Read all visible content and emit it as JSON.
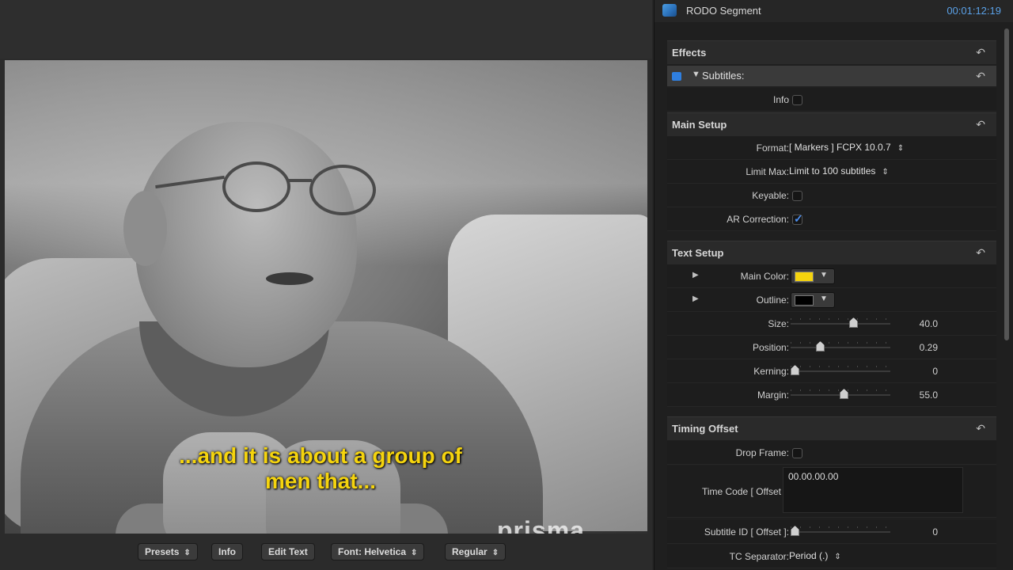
{
  "viewer": {
    "subtitle_line1": "...and it is about a group of",
    "subtitle_line2": "men that...",
    "watermark": "prisma",
    "toolbar": [
      {
        "label": "Presets",
        "arrow": "⇕"
      },
      {
        "label": "Info",
        "arrow": ""
      },
      {
        "label": "Edit Text",
        "arrow": ""
      },
      {
        "label": "Font: Helvetica",
        "arrow": "⇕"
      },
      {
        "label": "Regular",
        "arrow": "⇕"
      }
    ]
  },
  "inspector": {
    "title": "RODO Segment",
    "timecode": "00:01:12:19",
    "effects_label": "Effects",
    "subtitles_label": "Subtitles:",
    "info_label": "Info",
    "main_setup": {
      "title": "Main Setup",
      "format_label": "Format:",
      "format_value": "[ Markers ] FCPX 10.0.7",
      "limit_label": "Limit Max:",
      "limit_value": "Limit to 100 subtitles",
      "keyable_label": "Keyable:",
      "ar_label": "AR Correction:"
    },
    "text_setup": {
      "title": "Text Setup",
      "main_color_label": "Main Color:",
      "main_color": "#f5d40e",
      "outline_label": "Outline:",
      "outline_color": "#000000",
      "size_label": "Size:",
      "size_value": "40.0",
      "position_label": "Position:",
      "position_value": "0.29",
      "kerning_label": "Kerning:",
      "kerning_value": "0",
      "margin_label": "Margin:",
      "margin_value": "55.0"
    },
    "timing_offset": {
      "title": "Timing Offset",
      "drop_frame_label": "Drop Frame:",
      "timecode_offset_label": "Time Code [ Offset ]:",
      "timecode_offset_value": "00.00.00.00",
      "subtitle_id_label": "Subtitle ID [ Offset ]:",
      "subtitle_id_value": "0",
      "tc_separator_label": "TC Separator:",
      "tc_separator_value": "Period (.)"
    }
  }
}
